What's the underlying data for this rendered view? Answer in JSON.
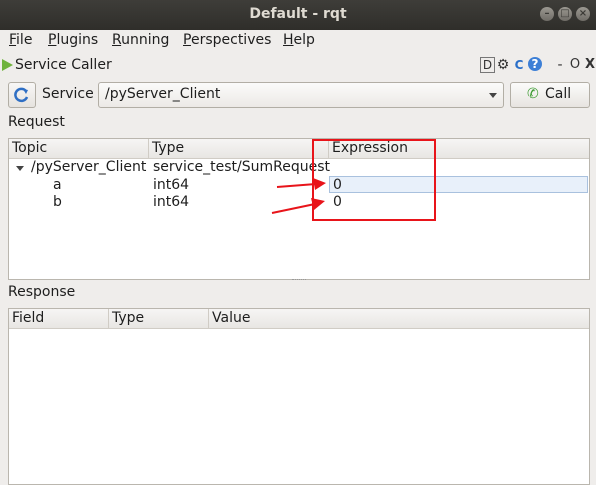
{
  "window": {
    "title": "Default - rqt",
    "controls": [
      "minimize",
      "maximize",
      "close"
    ]
  },
  "menu": [
    {
      "label": "File",
      "mnemonic": "F",
      "rest": "ile"
    },
    {
      "label": "Plugins",
      "mnemonic": "P",
      "rest": "lugins"
    },
    {
      "label": "Running",
      "mnemonic": "R",
      "rest": "unning"
    },
    {
      "label": "Perspectives",
      "mnemonic": "P",
      "rest": "erspectives"
    },
    {
      "label": "Help",
      "mnemonic": "H",
      "rest": "elp"
    }
  ],
  "plugin": {
    "title": "Service Caller",
    "icons": {
      "d": "D",
      "gear": "⚙",
      "reload": "C",
      "help": "?",
      "minimize": "-",
      "close": "O"
    }
  },
  "service": {
    "label": "Service",
    "selected": "/pyServer_Client",
    "call_label": "Call"
  },
  "request": {
    "label": "Request",
    "columns": [
      "Topic",
      "Type",
      "Expression"
    ],
    "root": {
      "topic": "/pyServer_Client",
      "type": "service_test/SumRequest"
    },
    "rows": [
      {
        "topic": "a",
        "type": "int64",
        "expression": "0"
      },
      {
        "topic": "b",
        "type": "int64",
        "expression": "0"
      }
    ]
  },
  "response": {
    "label": "Response",
    "columns": [
      "Field",
      "Type",
      "Value"
    ]
  },
  "colors": {
    "annotation": "#e8141a",
    "titlebar": "#2f2e2a",
    "accent_green": "#6fb33d"
  }
}
